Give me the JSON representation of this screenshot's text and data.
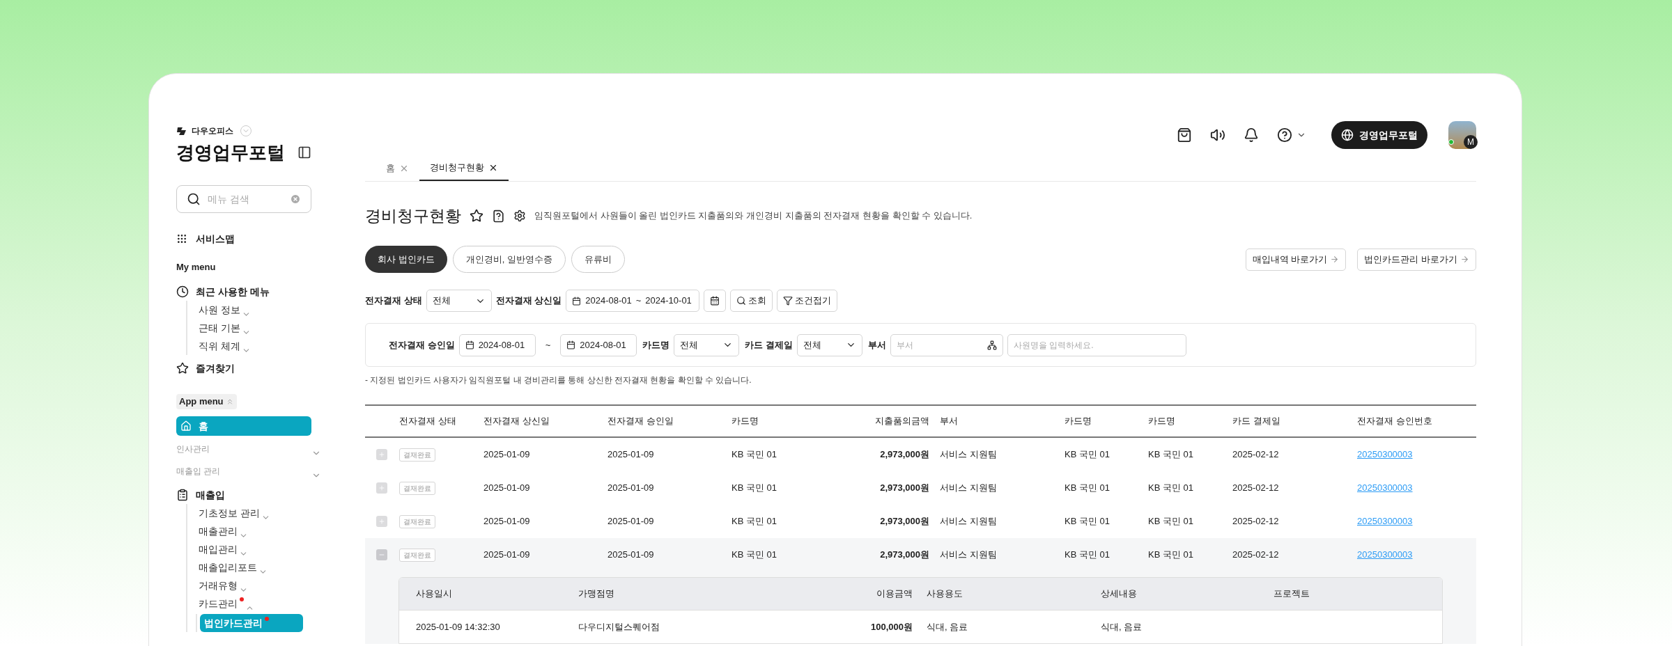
{
  "sidebar": {
    "brand": "다우오피스",
    "title": "경영업무포털",
    "search": {
      "placeholder": "메뉴 검색"
    },
    "service_map": "서비스맵",
    "my_menu_heading": "My menu",
    "recent": {
      "label": "최근 사용한 메뉴",
      "children": [
        {
          "label": "사원 정보"
        },
        {
          "label": "근태 기본"
        },
        {
          "label": "직위 체계"
        }
      ]
    },
    "favorites": "즐겨찾기",
    "app_menu_label": "App menu",
    "items": [
      {
        "kind": "home",
        "label": "홈",
        "selected": true
      },
      {
        "kind": "group",
        "label": "인사관리",
        "expanded": false
      },
      {
        "kind": "group",
        "label": "매출입 관리",
        "expanded": false
      },
      {
        "kind": "section",
        "label": "매출입",
        "children": [
          {
            "label": "기초정보 관리",
            "expanded": false,
            "dot": false,
            "selected": false
          },
          {
            "label": "매출관리",
            "expanded": false,
            "dot": false,
            "selected": false
          },
          {
            "label": "매입관리",
            "expanded": false,
            "dot": false,
            "selected": false
          },
          {
            "label": "매출입리포트",
            "expanded": false,
            "dot": false,
            "selected": false
          },
          {
            "label": "거래유형",
            "expanded": false,
            "dot": false,
            "selected": false
          },
          {
            "label": "카드관리",
            "expanded": true,
            "dot": true,
            "selected": false,
            "children": [
              {
                "label": "법인카드관리",
                "dot": true,
                "selected": true
              }
            ]
          }
        ]
      }
    ]
  },
  "topbar": {
    "portal_button": "경영업무포털",
    "avatar": {
      "initial": "M",
      "online": true
    }
  },
  "tabs": [
    {
      "label": "홈",
      "selected": false
    },
    {
      "label": "경비청구현황",
      "selected": true
    }
  ],
  "page": {
    "title": "경비청구현황",
    "description": "임직원포털에서 사원들이 올린 법인카드 지출품의와 개인경비 지출품의 전자결재 현황을 확인할 수 있습니다."
  },
  "categories": [
    {
      "label": "회사 법인카드",
      "selected": true
    },
    {
      "label": "개인경비, 일반영수증",
      "selected": false
    },
    {
      "label": "유류비",
      "selected": false
    }
  ],
  "shortcuts": [
    "매입내역 바로가기",
    "법인카드관리 바로가기"
  ],
  "filters": [
    {
      "kind": "select",
      "label": "전자결재 상태",
      "value": "전체"
    },
    {
      "kind": "daterange",
      "label": "전자결재 상신일",
      "start": "2024-08-01",
      "separator": "~",
      "end": "2024-10-01"
    }
  ],
  "filter_buttons": {
    "search": "조회",
    "collapse": "조건접기"
  },
  "advanced_filters": {
    "approval_label": "전자결재 승인일",
    "approval_start": "2024-08-01",
    "approval_separator": "~",
    "approval_end": "2024-08-01",
    "card_label": "카드명",
    "card_value": "전체",
    "payday_label": "카드 결제일",
    "payday_value": "전체",
    "dept_label": "부서",
    "dept_placeholder": "부서",
    "employee_placeholder": "사원명을 입력하세요."
  },
  "note": "- 지정된 법인카드 사용자가 임직원포털 내 경비관리를 통해 상신한 전자결재 현황을 확인할 수 있습니다.",
  "table": {
    "columns": [
      "전자결재 상태",
      "전자결재 상신일",
      "전자결재 승인일",
      "카드명",
      "지출품의금액",
      "부서",
      "카드명",
      "카드명",
      "카드 결제일",
      "전자결재 승인번호"
    ],
    "rows": [
      {
        "expanded": false,
        "cells": [
          "결재완료",
          "2025-01-09",
          "2025-01-09",
          "KB 국민 01",
          "2,973,000원",
          "서비스 지원팀",
          "KB 국민 01",
          "KB 국민 01",
          "2025-02-12",
          "20250300003"
        ]
      },
      {
        "expanded": false,
        "cells": [
          "결재완료",
          "2025-01-09",
          "2025-01-09",
          "KB 국민 01",
          "2,973,000원",
          "서비스 지원팀",
          "KB 국민 01",
          "KB 국민 01",
          "2025-02-12",
          "20250300003"
        ]
      },
      {
        "expanded": false,
        "cells": [
          "결재완료",
          "2025-01-09",
          "2025-01-09",
          "KB 국민 01",
          "2,973,000원",
          "서비스 지원팀",
          "KB 국민 01",
          "KB 국민 01",
          "2025-02-12",
          "20250300003"
        ]
      },
      {
        "expanded": true,
        "cells": [
          "결재완료",
          "2025-01-09",
          "2025-01-09",
          "KB 국민 01",
          "2,973,000원",
          "서비스 지원팀",
          "KB 국민 01",
          "KB 국민 01",
          "2025-02-12",
          "20250300003"
        ],
        "detail": {
          "columns": [
            "사용일시",
            "가맹점명",
            "이용금액",
            "사용용도",
            "상세내용",
            "프로젝트"
          ],
          "rows": [
            [
              "2025-01-09 14:32:30",
              "다우디지털스퀘어점",
              "100,000원",
              "식대, 음료",
              "식대, 음료"
            ]
          ]
        }
      }
    ]
  }
}
